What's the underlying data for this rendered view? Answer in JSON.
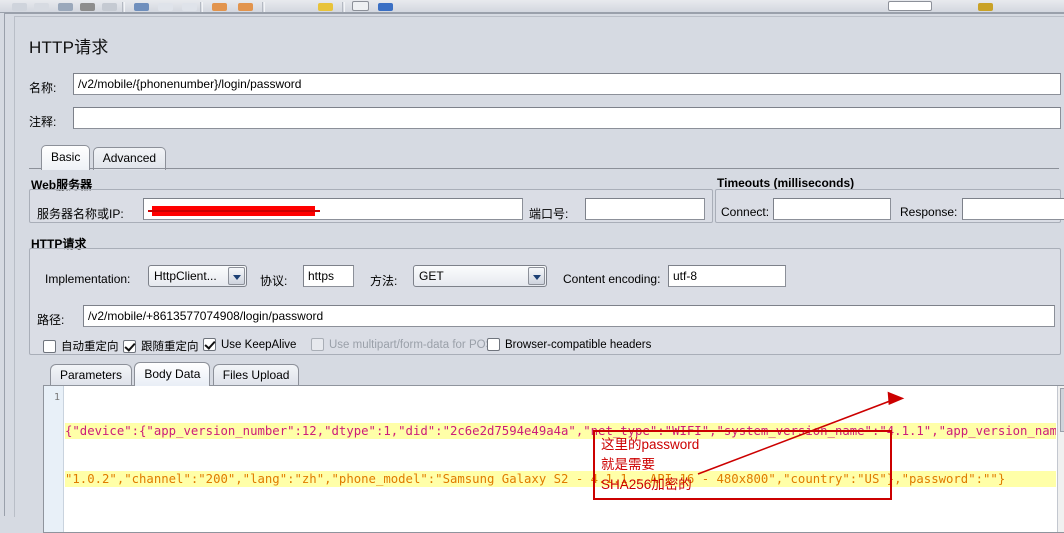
{
  "window": {
    "panel_title": "HTTP请求"
  },
  "toolbar": {
    "icons": [
      "new-icon",
      "open-icon",
      "save-icon",
      "save-all-icon",
      "close-icon",
      "cut-icon",
      "copy-icon",
      "paste-icon",
      "expand-icon",
      "collapse-icon",
      "toggle-icon",
      "run-icon",
      "stop-icon",
      "shutdown-icon",
      "clear-icon",
      "clear-all-icon",
      "search-icon",
      "help-icon",
      "timer-field",
      "warning-icon"
    ]
  },
  "fields": {
    "name_label": "名称:",
    "name_value": "/v2/mobile/{phonenumber}/login/password",
    "comment_label": "注释:",
    "comment_value": ""
  },
  "tabs": {
    "items": [
      {
        "label": "Basic",
        "selected": true
      },
      {
        "label": "Advanced",
        "selected": false
      }
    ]
  },
  "web_server": {
    "group_title": "Web服务器",
    "server_label": "服务器名称或IP:",
    "server_value": "",
    "server_redacted": true,
    "port_label": "端口号:",
    "port_value": ""
  },
  "timeouts": {
    "group_title": "Timeouts (milliseconds)",
    "connect_label": "Connect:",
    "connect_value": "",
    "response_label": "Response:",
    "response_value": ""
  },
  "http_request": {
    "group_title": "HTTP请求",
    "implementation_label": "Implementation:",
    "implementation_value": "HttpClient...",
    "protocol_label": "协议:",
    "protocol_value": "https",
    "method_label": "方法:",
    "method_value": "GET",
    "content_encoding_label": "Content encoding:",
    "content_encoding_value": "utf-8",
    "path_label": "路径:",
    "path_value": "/v2/mobile/+8613577074908/login/password"
  },
  "checkboxes": [
    {
      "label": "自动重定向",
      "checked": false,
      "disabled": false,
      "name": "auto-redirect"
    },
    {
      "label": "跟随重定向",
      "checked": true,
      "disabled": false,
      "name": "follow-redirects"
    },
    {
      "label": "Use KeepAlive",
      "checked": true,
      "disabled": false,
      "name": "use-keepalive"
    },
    {
      "label": "Use multipart/form-data for POST",
      "checked": false,
      "disabled": true,
      "name": "use-multipart"
    },
    {
      "label": "Browser-compatible headers",
      "checked": false,
      "disabled": false,
      "name": "browser-compatible-headers"
    }
  ],
  "body_tabs": {
    "items": [
      {
        "label": "Parameters",
        "selected": false
      },
      {
        "label": "Body Data",
        "selected": true
      },
      {
        "label": "Files Upload",
        "selected": false
      }
    ]
  },
  "editor": {
    "line_number": "1",
    "line1": "{\"device\":{\"app_version_number\":12,\"dtype\":1,\"did\":\"2c6e2d7594e49a4a\",\"net_type\":\"WIFI\",\"system_version_name\":\"4.1.1\",\"app_version_name\":",
    "line2": "\"1.0.2\",\"channel\":\"200\",\"lang\":\"zh\",\"phone_model\":\"Samsung Galaxy S2 - 4.1.1 - API 16 - 480x800\",\"country\":\"US\"},\"password\":\"\"}"
  },
  "annotation": {
    "line1": "这里的password",
    "line2": "就是需要",
    "line3": "SHA256加密的",
    "color": "#cc0000"
  }
}
